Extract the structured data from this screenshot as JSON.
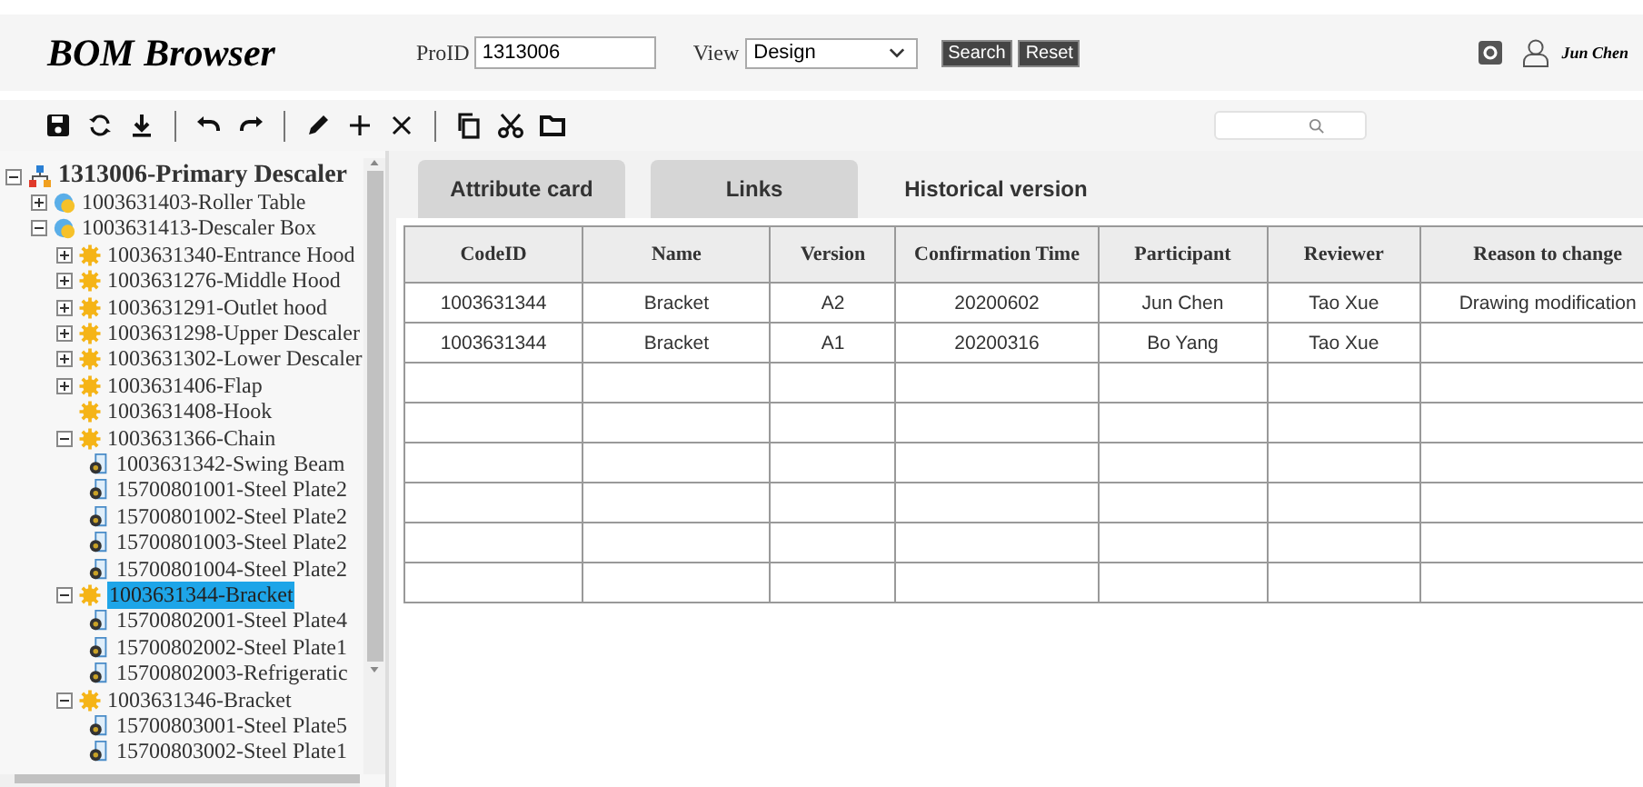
{
  "app_title": "BOM Browser",
  "filters": {
    "proid_label": "ProID",
    "proid_value": "1313006",
    "view_label": "View",
    "view_value": "Design",
    "buttons": [
      "Search",
      "Reset"
    ]
  },
  "user": {
    "name": "Jun Chen"
  },
  "tree": [
    {
      "label": "1313006-Primary Descaler",
      "kind": "root",
      "expanded": true,
      "children": [
        {
          "label": "1003631403-Roller Table",
          "kind": "assembly",
          "expanded": false
        },
        {
          "label": "1003631413-Descaler Box",
          "kind": "assembly",
          "expanded": true,
          "children": [
            {
              "label": "1003631340-Entrance Hood",
              "kind": "part",
              "expanded": false
            },
            {
              "label": "1003631276-Middle Hood",
              "kind": "part",
              "expanded": false
            },
            {
              "label": "1003631291-Outlet hood",
              "kind": "part",
              "expanded": false
            },
            {
              "label": "1003631298-Upper Descaler",
              "kind": "part",
              "expanded": false
            },
            {
              "label": "1003631302-Lower Descaler",
              "kind": "part",
              "expanded": false
            },
            {
              "label": "1003631406-Flap",
              "kind": "part",
              "expanded": false
            },
            {
              "label": "1003631408-Hook",
              "kind": "part"
            },
            {
              "label": "1003631366-Chain",
              "kind": "part",
              "expanded": true,
              "children": [
                {
                  "label": "1003631342-Swing Beam",
                  "kind": "doc"
                },
                {
                  "label": "15700801001-Steel Plate2",
                  "kind": "doc"
                },
                {
                  "label": "15700801002-Steel Plate2",
                  "kind": "doc"
                },
                {
                  "label": "15700801003-Steel Plate2",
                  "kind": "doc"
                },
                {
                  "label": "15700801004-Steel Plate2",
                  "kind": "doc"
                }
              ]
            },
            {
              "label": "1003631344-Bracket",
              "kind": "part",
              "expanded": true,
              "selected": true,
              "children": [
                {
                  "label": "15700802001-Steel Plate4",
                  "kind": "doc"
                },
                {
                  "label": "15700802002-Steel Plate1",
                  "kind": "doc"
                },
                {
                  "label": "15700802003-Refrigeratic",
                  "kind": "doc"
                }
              ]
            },
            {
              "label": "1003631346-Bracket",
              "kind": "part",
              "expanded": true,
              "children": [
                {
                  "label": "15700803001-Steel Plate5",
                  "kind": "doc"
                },
                {
                  "label": "15700803002-Steel Plate1",
                  "kind": "doc"
                }
              ]
            }
          ]
        }
      ]
    }
  ],
  "tabs": [
    {
      "label": "Attribute card",
      "selected": false
    },
    {
      "label": "Links",
      "selected": false
    },
    {
      "label": "Historical version",
      "selected": true
    }
  ],
  "table": {
    "columns": [
      "CodeID",
      "Name",
      "Version",
      "Confirmation Time",
      "Participant",
      "Reviewer",
      "Reason to change"
    ],
    "rows": [
      [
        "1003631344",
        "Bracket",
        "A2",
        "20200602",
        "Jun Chen",
        "Tao Xue",
        "Drawing modification"
      ],
      [
        "1003631344",
        "Bracket",
        "A1",
        "20200316",
        "Bo Yang",
        "Tao Xue",
        ""
      ]
    ]
  }
}
